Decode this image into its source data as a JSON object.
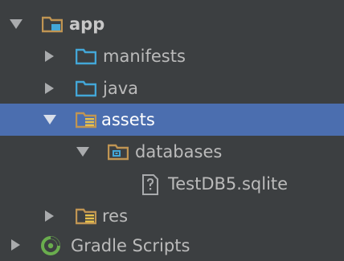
{
  "project_tree": {
    "app": {
      "label": "app",
      "icon": "module-folder-icon",
      "expanded": true
    },
    "manifests": {
      "label": "manifests",
      "icon": "folder-icon",
      "expanded": false
    },
    "java": {
      "label": "java",
      "icon": "folder-icon",
      "expanded": false
    },
    "assets": {
      "label": "assets",
      "icon": "resource-folder-icon",
      "expanded": true,
      "selected": true
    },
    "databases": {
      "label": "databases",
      "icon": "package-folder-icon",
      "expanded": true
    },
    "testdb": {
      "label": "TestDB5.sqlite",
      "icon": "unknown-file-icon"
    },
    "res": {
      "label": "res",
      "icon": "resource-folder-icon",
      "expanded": false
    },
    "gradle": {
      "label": "Gradle Scripts",
      "icon": "gradle-icon",
      "expanded": false
    }
  },
  "colors": {
    "background": "#3c3f41",
    "selection": "#4b6eaf",
    "text": "#bbbbbb",
    "folder_blue": "#43a7d8",
    "folder_orange": "#c09553",
    "resource_yellow": "#e8c14c",
    "gradle_green": "#6aad4e"
  }
}
